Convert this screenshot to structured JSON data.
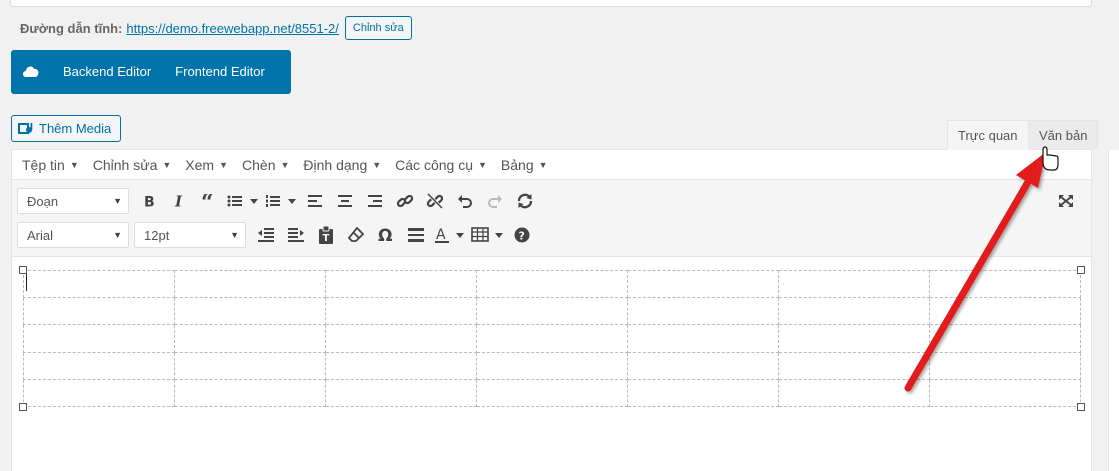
{
  "permalink": {
    "label": "Đường dẫn tĩnh:",
    "url_text": "https://demo.freewebapp.net/8551-2/",
    "edit_label": "Chỉnh sửa"
  },
  "builder": {
    "backend_label": "Backend Editor",
    "frontend_label": "Frontend Editor",
    "color": "#0073aa"
  },
  "media": {
    "add_label": "Thêm Media"
  },
  "tabs": {
    "visual_label": "Trực quan",
    "text_label": "Văn bản"
  },
  "menubar": {
    "items": [
      "Tệp tin",
      "Chỉnh sửa",
      "Xem",
      "Chèn",
      "Định dạng",
      "Các công cụ",
      "Bảng"
    ]
  },
  "toolbar": {
    "format_value": "Đoạn",
    "font_value": "Arial",
    "size_value": "12pt"
  },
  "table": {
    "rows": 5,
    "cols": 7
  },
  "annotation": {
    "arrow_color": "#e21b1b"
  }
}
